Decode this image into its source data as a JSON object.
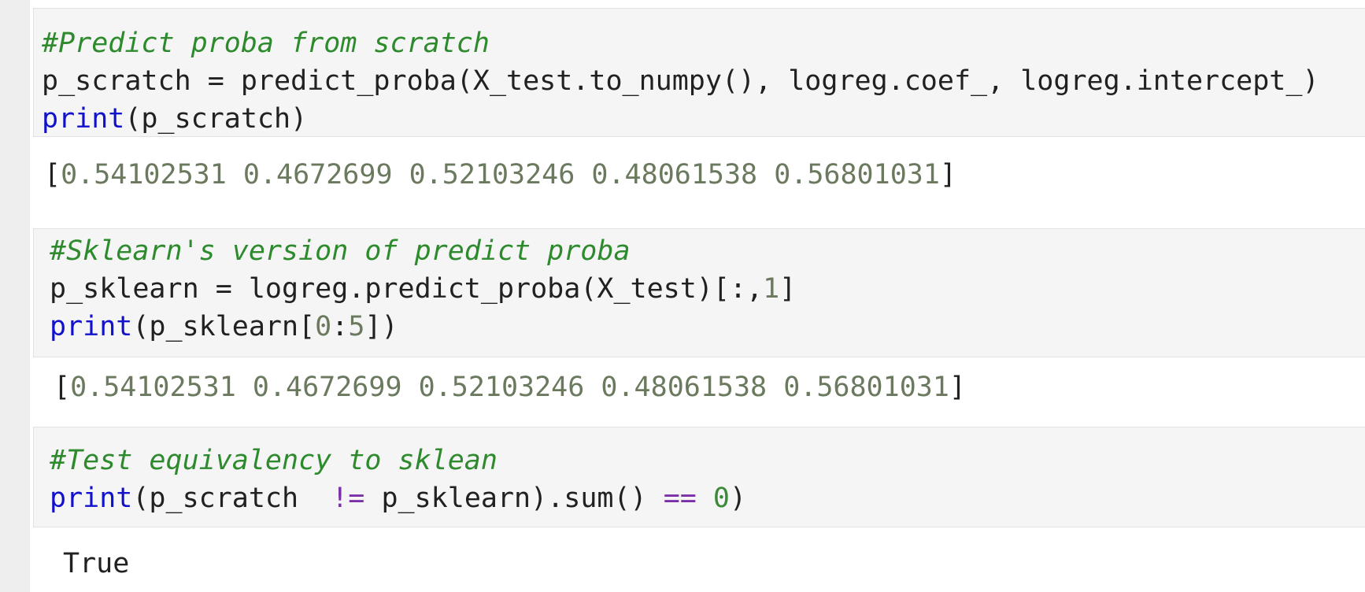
{
  "cells": [
    {
      "code": {
        "comment": "#Predict proba from scratch",
        "line2": "p_scratch = predict_proba(X_test.to_numpy(), logreg.coef_, logreg.intercept_)",
        "line3_func": "print",
        "line3_rest": "(p_scratch)"
      },
      "output": {
        "open": "[",
        "values": [
          "0.54102531",
          "0.4672699",
          "0.52103246",
          "0.48061538",
          "0.56801031"
        ],
        "close": "]"
      }
    },
    {
      "code": {
        "comment": "#Sklearn's version of predict proba",
        "line2_a": "p_sklearn = logreg.predict_proba(X_test)[:,",
        "line2_num": "1",
        "line2_b": "]",
        "line3_func": "print",
        "line3_a": "(p_sklearn[",
        "line3_n1": "0",
        "line3_colon": ":",
        "line3_n2": "5",
        "line3_b": "])"
      },
      "output": {
        "open": "[",
        "values": [
          "0.54102531",
          "0.4672699",
          "0.52103246",
          "0.48061538",
          "0.56801031"
        ],
        "close": "]"
      }
    },
    {
      "code": {
        "comment": "#Test equivalency to sklean",
        "line2_func": "print",
        "line2_a": "(p_scratch  ",
        "line2_op1": "!=",
        "line2_b": " p_sklearn).sum() ",
        "line2_op2": "==",
        "line2_sp": " ",
        "line2_num": "0",
        "line2_c": ")"
      },
      "output": {
        "text": "True"
      }
    }
  ]
}
